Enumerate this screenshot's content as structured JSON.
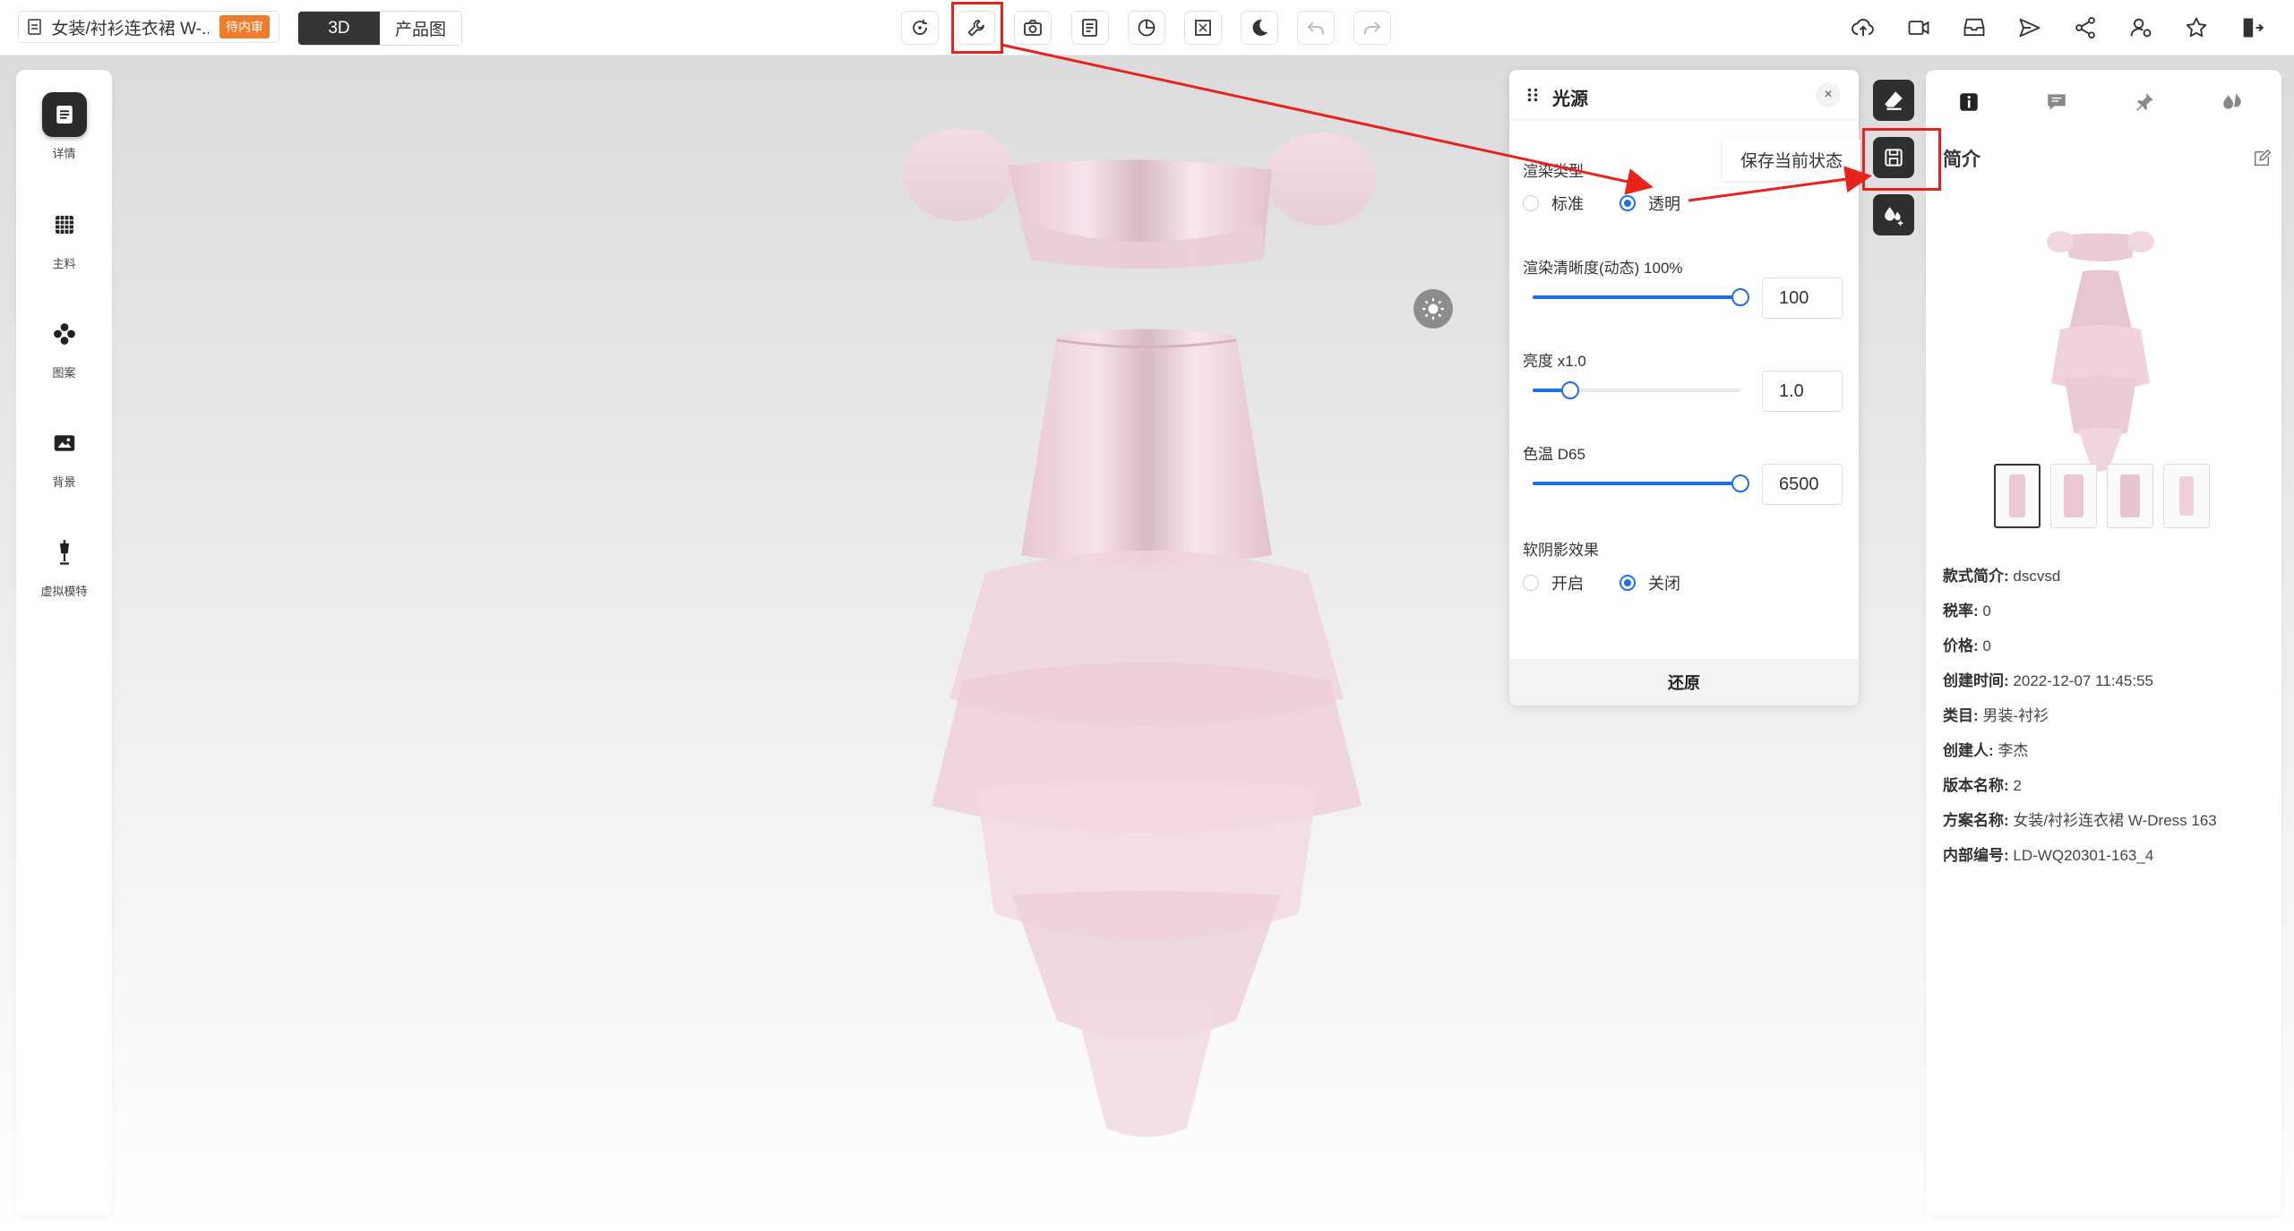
{
  "header": {
    "doc_title": "女装/衬衫连衣裙 W-...",
    "status_badge": "待内审",
    "modes": {
      "mode_3d": "3D",
      "mode_product": "产品图"
    }
  },
  "toolbar_center": [
    {
      "icon": "rotate-icon"
    },
    {
      "icon": "wrench-icon",
      "highlighted": true
    },
    {
      "icon": "camera-icon"
    },
    {
      "icon": "document-edit-icon"
    },
    {
      "icon": "pie-clock-icon"
    },
    {
      "icon": "fullscreen-icon"
    },
    {
      "icon": "moon-icon"
    },
    {
      "icon": "undo-icon",
      "disabled": true
    },
    {
      "icon": "redo-icon",
      "disabled": true
    }
  ],
  "toolbar_right": [
    {
      "icon": "cloud-upload-icon"
    },
    {
      "icon": "video-icon"
    },
    {
      "icon": "save-drive-icon"
    },
    {
      "icon": "send-icon"
    },
    {
      "icon": "share-icon"
    },
    {
      "icon": "user-settings-icon"
    },
    {
      "icon": "star-icon"
    },
    {
      "icon": "exit-icon"
    }
  ],
  "left_sidebar": {
    "items": [
      {
        "label": "详情",
        "icon": "details-icon",
        "active": true
      },
      {
        "label": "主料",
        "icon": "grid-icon"
      },
      {
        "label": "图案",
        "icon": "pattern-icon"
      },
      {
        "label": "背景",
        "icon": "background-icon"
      },
      {
        "label": "虚拟模特",
        "icon": "mannequin-icon"
      }
    ]
  },
  "light_panel": {
    "title": "光源",
    "close": "×",
    "render_type": {
      "label": "渲染类型",
      "options": [
        "标准",
        "透明"
      ],
      "selected": "透明"
    },
    "clarity": {
      "label": "渲染清晰度(动态) 100%",
      "value": "100",
      "fraction": 1.0
    },
    "brightness": {
      "label": "亮度 x1.0",
      "value": "1.0",
      "fraction": 0.18
    },
    "color_temp": {
      "label": "色温 D65",
      "value": "6500",
      "fraction": 1.0
    },
    "soft_shadow": {
      "label": "软阴影效果",
      "options": [
        "开启",
        "关闭"
      ],
      "selected": "关闭"
    },
    "restore_button": "还原"
  },
  "side_tools": [
    {
      "icon": "eraser-icon"
    },
    {
      "icon": "save-state-icon",
      "tooltip": "保存当前状态"
    },
    {
      "icon": "drops-plus-icon"
    }
  ],
  "right_panel": {
    "tabs": [
      {
        "icon": "info-icon",
        "active": true
      },
      {
        "icon": "comment-icon"
      },
      {
        "icon": "pin-icon"
      },
      {
        "icon": "drops-icon"
      }
    ],
    "title": "简介",
    "info": [
      {
        "key": "款式简介:",
        "value": "dscvsd"
      },
      {
        "key": "税率:",
        "value": "0"
      },
      {
        "key": "价格:",
        "value": "0"
      },
      {
        "key": "创建时间:",
        "value": "2022-12-07 11:45:55"
      },
      {
        "key": "类目:",
        "value": "男装-衬衫"
      },
      {
        "key": "创建人:",
        "value": "李杰"
      },
      {
        "key": "版本名称:",
        "value": "2"
      },
      {
        "key": "方案名称:",
        "value": "女装/衬衫连衣裙 W-Dress 163"
      },
      {
        "key": "内部编号:",
        "value": "LD-WQ20301-163_4"
      }
    ]
  },
  "colors": {
    "accent": "#1e6fe8",
    "badge": "#f07c2b",
    "annotation": "#e8231c",
    "garment": "#f2d3df"
  }
}
